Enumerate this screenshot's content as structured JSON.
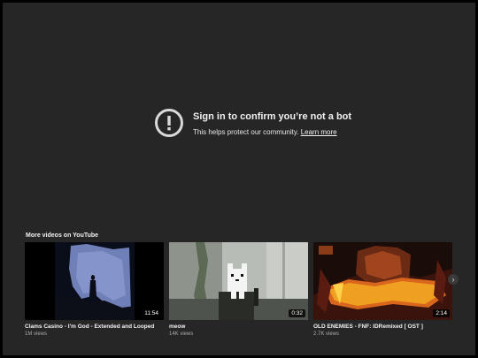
{
  "message": {
    "title": "Sign in to confirm you’re not a bot",
    "subtitle": "This helps protect our community.",
    "link": "Learn more",
    "icon": "alert-circle-icon"
  },
  "more_videos": {
    "heading": "More videos on YouTube",
    "videos": [
      {
        "title": "Clams Casino - I'm God - Extended and Looped",
        "views": "1M views",
        "duration": "11:54"
      },
      {
        "title": "meow",
        "views": "14K views",
        "duration": "0:32"
      },
      {
        "title": "OLD ENEMIES - FNF: IDRemixed [ OST ]",
        "views": "2.7K views",
        "duration": "2:14"
      }
    ],
    "next_icon": "chevron-right-icon"
  },
  "colors": {
    "background": "#262626",
    "text": "#f1f1f1",
    "muted": "#aaaaaa"
  }
}
